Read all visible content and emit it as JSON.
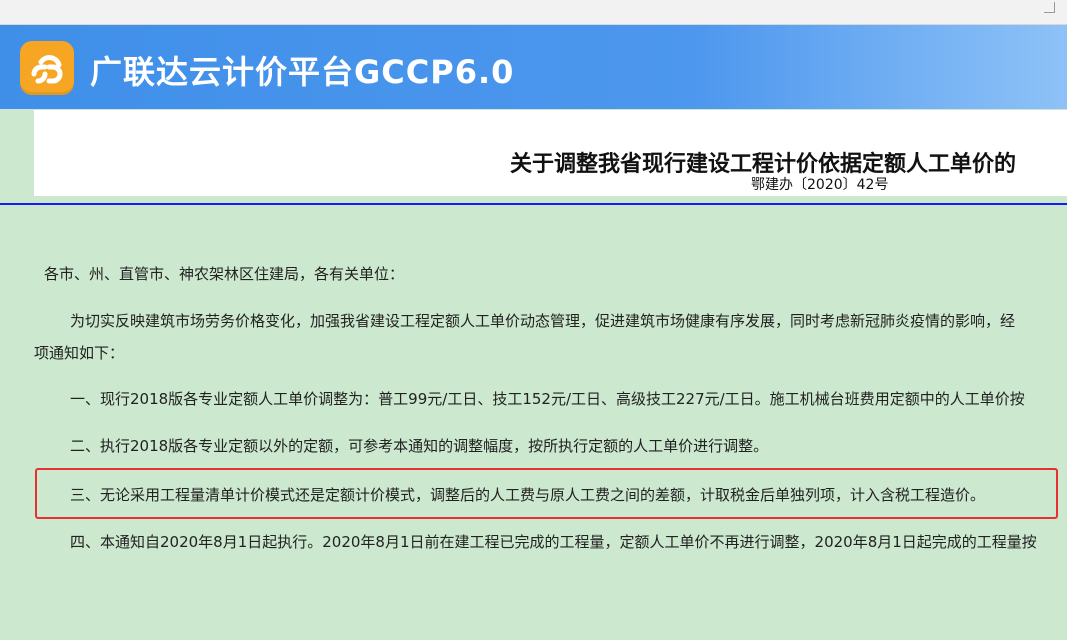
{
  "banner": {
    "title": "广联达云计价平台GCCP6.0",
    "logo_icon": "cloud-link-logo-icon",
    "colors": {
      "start": "#3f8fe9",
      "end": "#8ec2f7",
      "logo": "#f7a623"
    }
  },
  "document": {
    "title": "关于调整我省现行建设工程计价依据定额人工单价的",
    "number": "鄂建办〔2020〕42号",
    "salutation": "各市、州、直管市、神农架林区住建局，各有关单位：",
    "intro": "为切实反映建筑市场劳务价格变化，加强我省建设工程定额人工单价动态管理，促进建筑市场健康有序发展，同时考虑新冠肺炎疫情的影响，经",
    "intro_cont": "项通知如下：",
    "items": [
      "一、现行2018版各专业定额人工单价调整为：普工99元/工日、技工152元/工日、高级技工227元/工日。施工机械台班费用定额中的人工单价按",
      "二、执行2018版各专业定额以外的定额，可参考本通知的调整幅度，按所执行定额的人工单价进行调整。",
      "三、无论采用工程量清单计价模式还是定额计价模式，调整后的人工费与原人工费之间的差额，计取税金后单独列项，计入含税工程造价。",
      "四、本通知自2020年8月1日起执行。2020年8月1日前在建工程已完成的工程量，定额人工单价不再进行调整，2020年8月1日起完成的工程量按"
    ],
    "highlight_color": "#e83030",
    "rule_color": "#1a1aff"
  }
}
